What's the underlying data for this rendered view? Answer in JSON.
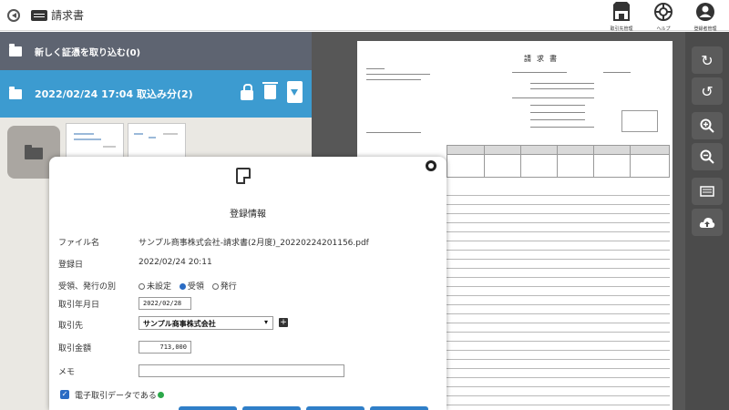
{
  "topbar": {
    "title": "請求書",
    "icons": [
      {
        "name": "store-icon",
        "caption": "取引先管理"
      },
      {
        "name": "help-icon",
        "caption": "ヘルプ"
      },
      {
        "name": "user-icon",
        "caption": "登録者管理"
      }
    ]
  },
  "left": {
    "new_row": "新しく証憑を取り込む(0)",
    "batch_row": "2022/02/24 17:04 取込み分(2)"
  },
  "preview": {
    "doc_title": "請求書"
  },
  "right_toolbar": {
    "buttons": [
      "rotate-cw-icon",
      "rotate-ccw-icon",
      "zoom-in-icon",
      "zoom-out-icon",
      "scan-icon",
      "cloud-upload-icon"
    ]
  },
  "modal": {
    "title": "登録情報",
    "fields": {
      "filename_label": "ファイル名",
      "filename_value": "サンプル商事株式会社-請求書(2月度)_20220224201156.pdf",
      "registered_label": "登録日",
      "registered_value": "2022/02/24 20:11",
      "direction_label": "受領、発行の別",
      "opt_unset": "未設定",
      "opt_received": "受領",
      "opt_issued": "発行",
      "date_label": "取引年月日",
      "date_value": "2022/02/28",
      "partner_label": "取引先",
      "partner_value": "サンプル商事株式会社",
      "amount_label": "取引金額",
      "amount_value": "713,000",
      "memo_label": "メモ",
      "memo_value": "",
      "edata_label": "電子取引データである"
    }
  }
}
